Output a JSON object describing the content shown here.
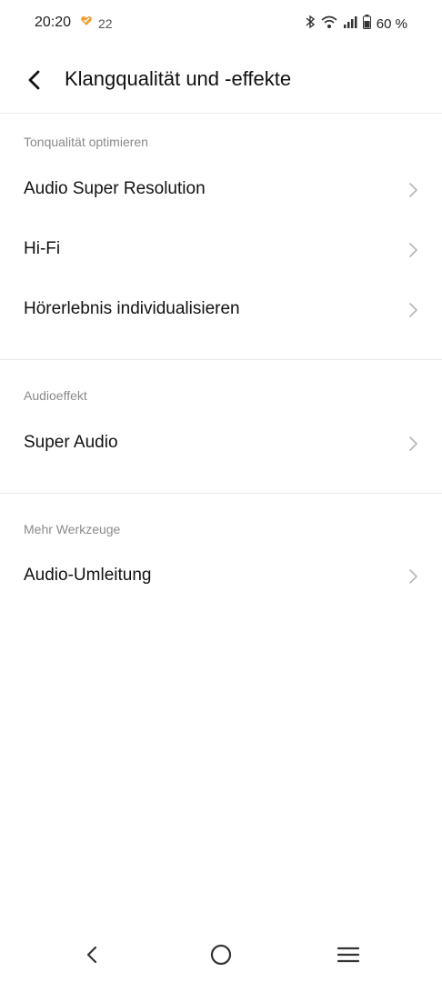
{
  "status_bar": {
    "time": "20:20",
    "notification_count": "22",
    "battery": "60 %",
    "icons": [
      "heart-icon",
      "bluetooth-icon",
      "wifi-icon",
      "signal-icon",
      "battery-icon"
    ]
  },
  "header": {
    "title": "Klangqualität und -effekte"
  },
  "sections": [
    {
      "title": "Tonqualität optimieren",
      "items": [
        {
          "label": "Audio Super Resolution"
        },
        {
          "label": "Hi-Fi"
        },
        {
          "label": "Hörerlebnis individualisieren"
        }
      ]
    },
    {
      "title": "Audioeffekt",
      "items": [
        {
          "label": "Super Audio"
        }
      ]
    },
    {
      "title": "Mehr Werkzeuge",
      "items": [
        {
          "label": "Audio-Umleitung"
        }
      ]
    }
  ],
  "nav_bar": {
    "icons": [
      "back-nav-icon",
      "home-nav-icon",
      "menu-nav-icon"
    ]
  },
  "colors": {
    "text": "#111111",
    "section_header": "#8a8a8a",
    "divider": "#e8e8e8",
    "chevron": "#b5b5b5",
    "heart": "#f0a030"
  }
}
